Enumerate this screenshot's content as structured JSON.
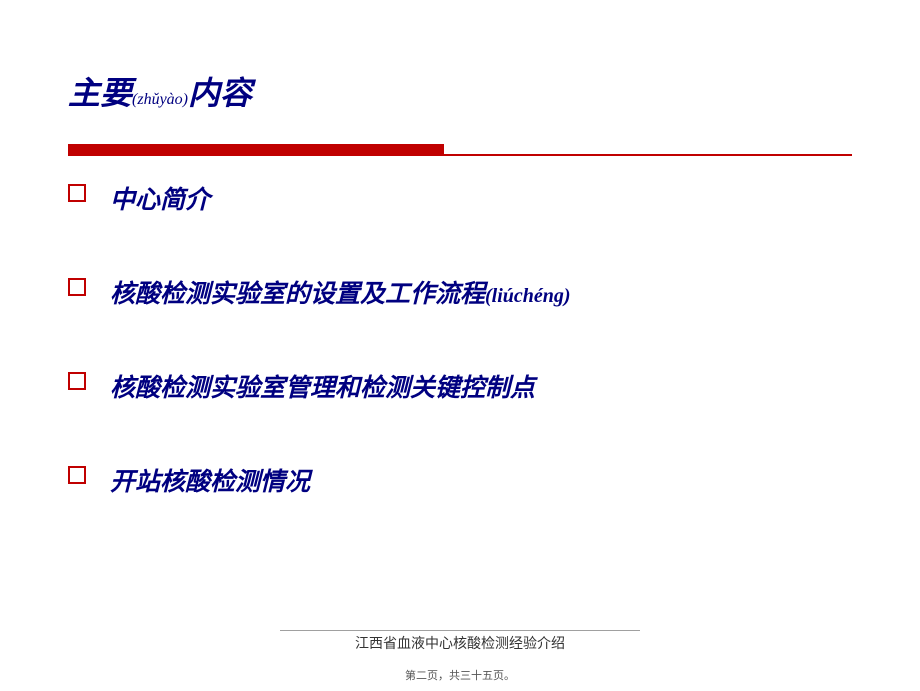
{
  "title": {
    "part1": "主要",
    "pinyin": "(zhǔyào)",
    "part2": "内容"
  },
  "items": [
    {
      "text": "中心简介",
      "pinyin": ""
    },
    {
      "text": "核酸检测实验室的设置及工作流程",
      "pinyin": "(liúchéng)"
    },
    {
      "text": "核酸检测实验室管理和检测关键控制点",
      "pinyin": ""
    },
    {
      "text": "开站核酸检测情况",
      "pinyin": ""
    }
  ],
  "footer": {
    "title": "江西省血液中心核酸检测经验介绍",
    "page": "第二页，共三十五页。"
  }
}
